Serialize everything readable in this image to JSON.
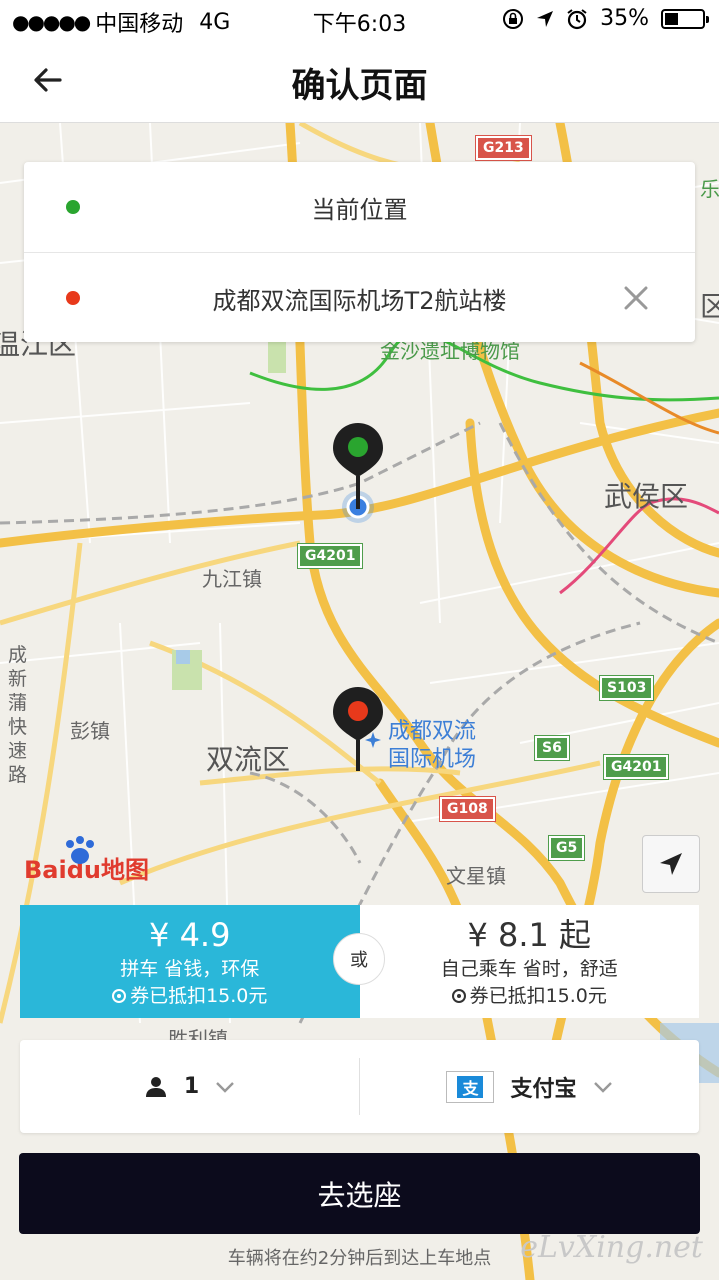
{
  "status_bar": {
    "signal": "●●●●●",
    "carrier": "中国移动",
    "network": "4G",
    "time": "下午6:03",
    "battery_percent": "35%",
    "battery_level": 0.35
  },
  "nav": {
    "title": "确认页面",
    "back_icon": "arrow-left-icon"
  },
  "locations": {
    "origin": {
      "label": "当前位置",
      "dot_color": "#2aa52f"
    },
    "destination": {
      "label": "成都双流国际机场T2航站楼",
      "dot_color": "#e8391b"
    },
    "clear_icon": "close-icon"
  },
  "map": {
    "labels": {
      "wenjiang": "温江区",
      "wuhou": "武侯区",
      "jiujiang": "九江镇",
      "pengzhen": "彭镇",
      "shuangliu": "双流区",
      "airport_line1": "成都双流",
      "airport_line2": "国际机场",
      "wenxing": "文星镇",
      "shengli": "胜利镇",
      "museum": "金沙遗址博物馆",
      "expressway": "成新蒲快速路",
      "edge_right": "区",
      "edge_top": "乐"
    },
    "shields": {
      "g213": "G213",
      "g4201_a": "G4201",
      "g4201_b": "G4201",
      "s103": "S103",
      "s6": "S6",
      "g108": "G108",
      "g5": "G5"
    },
    "logo": "Baidu地图",
    "locate_icon": "navigation-arrow-icon"
  },
  "pricing": {
    "carpool": {
      "price": "¥ 4.9",
      "desc": "拼车 省钱，环保",
      "coupon": "券已抵扣15.0元"
    },
    "solo": {
      "price": "¥ 8.1 起",
      "desc": "自己乘车 省时，舒适",
      "coupon": "券已抵扣15.0元"
    },
    "or_label": "或",
    "selected_color": "#2ab7d9"
  },
  "options": {
    "passengers": "1",
    "passenger_icon": "person-icon",
    "payment_method": "支付宝",
    "payment_icon": "alipay-icon"
  },
  "actions": {
    "primary": "去选座"
  },
  "footer": {
    "tip": "车辆将在约2分钟后到达上车地点",
    "watermark": "eLvXing.net"
  }
}
